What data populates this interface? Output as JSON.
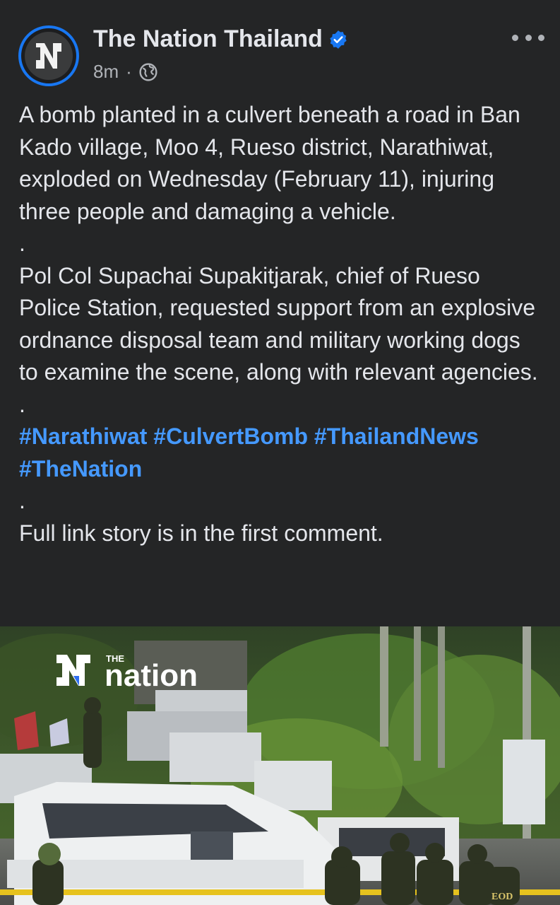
{
  "post": {
    "page_name": "The Nation Thailand",
    "time": "8m",
    "separator": "·",
    "privacy_icon": "globe-icon",
    "verified_icon": "verified-badge-icon",
    "more_icon": "more-options-icon",
    "paragraph1": "A bomb planted in a culvert beneath a road in Ban Kado village, Moo 4, Rueso district, Narathiwat, exploded on Wednesday (February 11), injuring three people and damaging a vehicle.",
    "dot1": ".",
    "paragraph2": "Pol Col Supachai Supakitjarak, chief of Rueso Police Station, requested support from an explosive ordnance disposal team and military working dogs to examine the scene, along with relevant agencies.",
    "dot2": ".",
    "hashtags": [
      "#Narathiwat",
      "#CulvertBomb",
      "#ThailandNews",
      "#TheNation"
    ],
    "dot3": ".",
    "paragraph3": "Full link story is in the first comment."
  },
  "photo": {
    "logo_small": "THE",
    "logo_main": "nation",
    "badge_text": "EOD"
  },
  "colors": {
    "background": "#242526",
    "text": "#e4e6eb",
    "secondary": "#b0b3b8",
    "link": "#4599ff",
    "accent": "#1877f2"
  }
}
